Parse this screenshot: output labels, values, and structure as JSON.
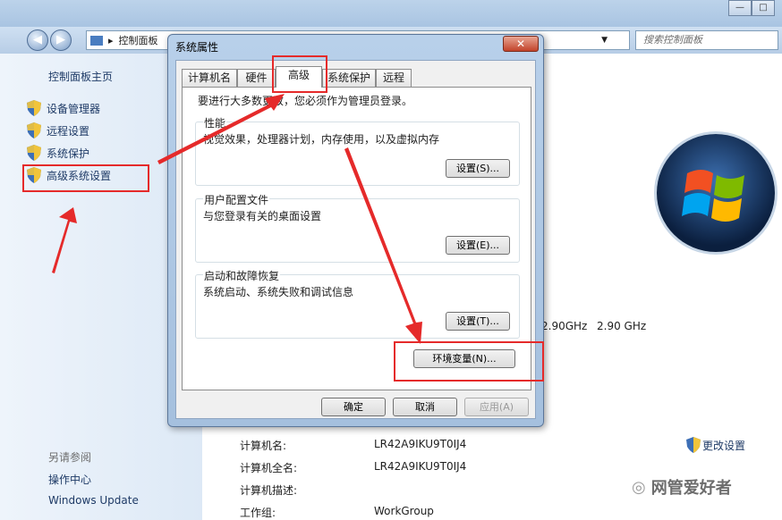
{
  "window": {
    "minimize": "—",
    "maximize": "□"
  },
  "nav": {
    "back": "◀",
    "forward": "▶",
    "breadcrumb": "控制面板",
    "search_placeholder": "搜索控制面板"
  },
  "sidebar": {
    "home": "控制面板主页",
    "items": [
      {
        "label": "设备管理器"
      },
      {
        "label": "远程设置"
      },
      {
        "label": "系统保护"
      },
      {
        "label": "高级系统设置"
      }
    ],
    "see_also_title": "另请参阅",
    "see_also": [
      "操作中心",
      "Windows Update"
    ]
  },
  "main": {
    "cpu_speed_1": "2.90GHz",
    "cpu_speed_2": "2.90 GHz",
    "change_settings": "更改设置",
    "rows": [
      {
        "label": "计算机名:",
        "value": "LR42A9IKU9T0IJ4"
      },
      {
        "label": "计算机全名:",
        "value": "LR42A9IKU9T0IJ4"
      },
      {
        "label": "计算机描述:",
        "value": ""
      },
      {
        "label": "工作组:",
        "value": "WorkGroup"
      }
    ],
    "watermark": "网管爱好者"
  },
  "dialog": {
    "title": "系统属性",
    "close": "✕",
    "tabs": [
      "计算机名",
      "硬件",
      "高级",
      "系统保护",
      "远程"
    ],
    "admin_note": "要进行大多数更改，您必须作为管理员登录。",
    "performance": {
      "title": "性能",
      "desc": "视觉效果，处理器计划，内存使用，以及虚拟内存",
      "button": "设置(S)..."
    },
    "profiles": {
      "title": "用户配置文件",
      "desc": "与您登录有关的桌面设置",
      "button": "设置(E)..."
    },
    "startup": {
      "title": "启动和故障恢复",
      "desc": "系统启动、系统失败和调试信息",
      "button": "设置(T)..."
    },
    "env_button": "环境变量(N)...",
    "ok": "确定",
    "cancel": "取消",
    "apply": "应用(A)"
  },
  "colors": {
    "annotation": "#e52a2a"
  }
}
